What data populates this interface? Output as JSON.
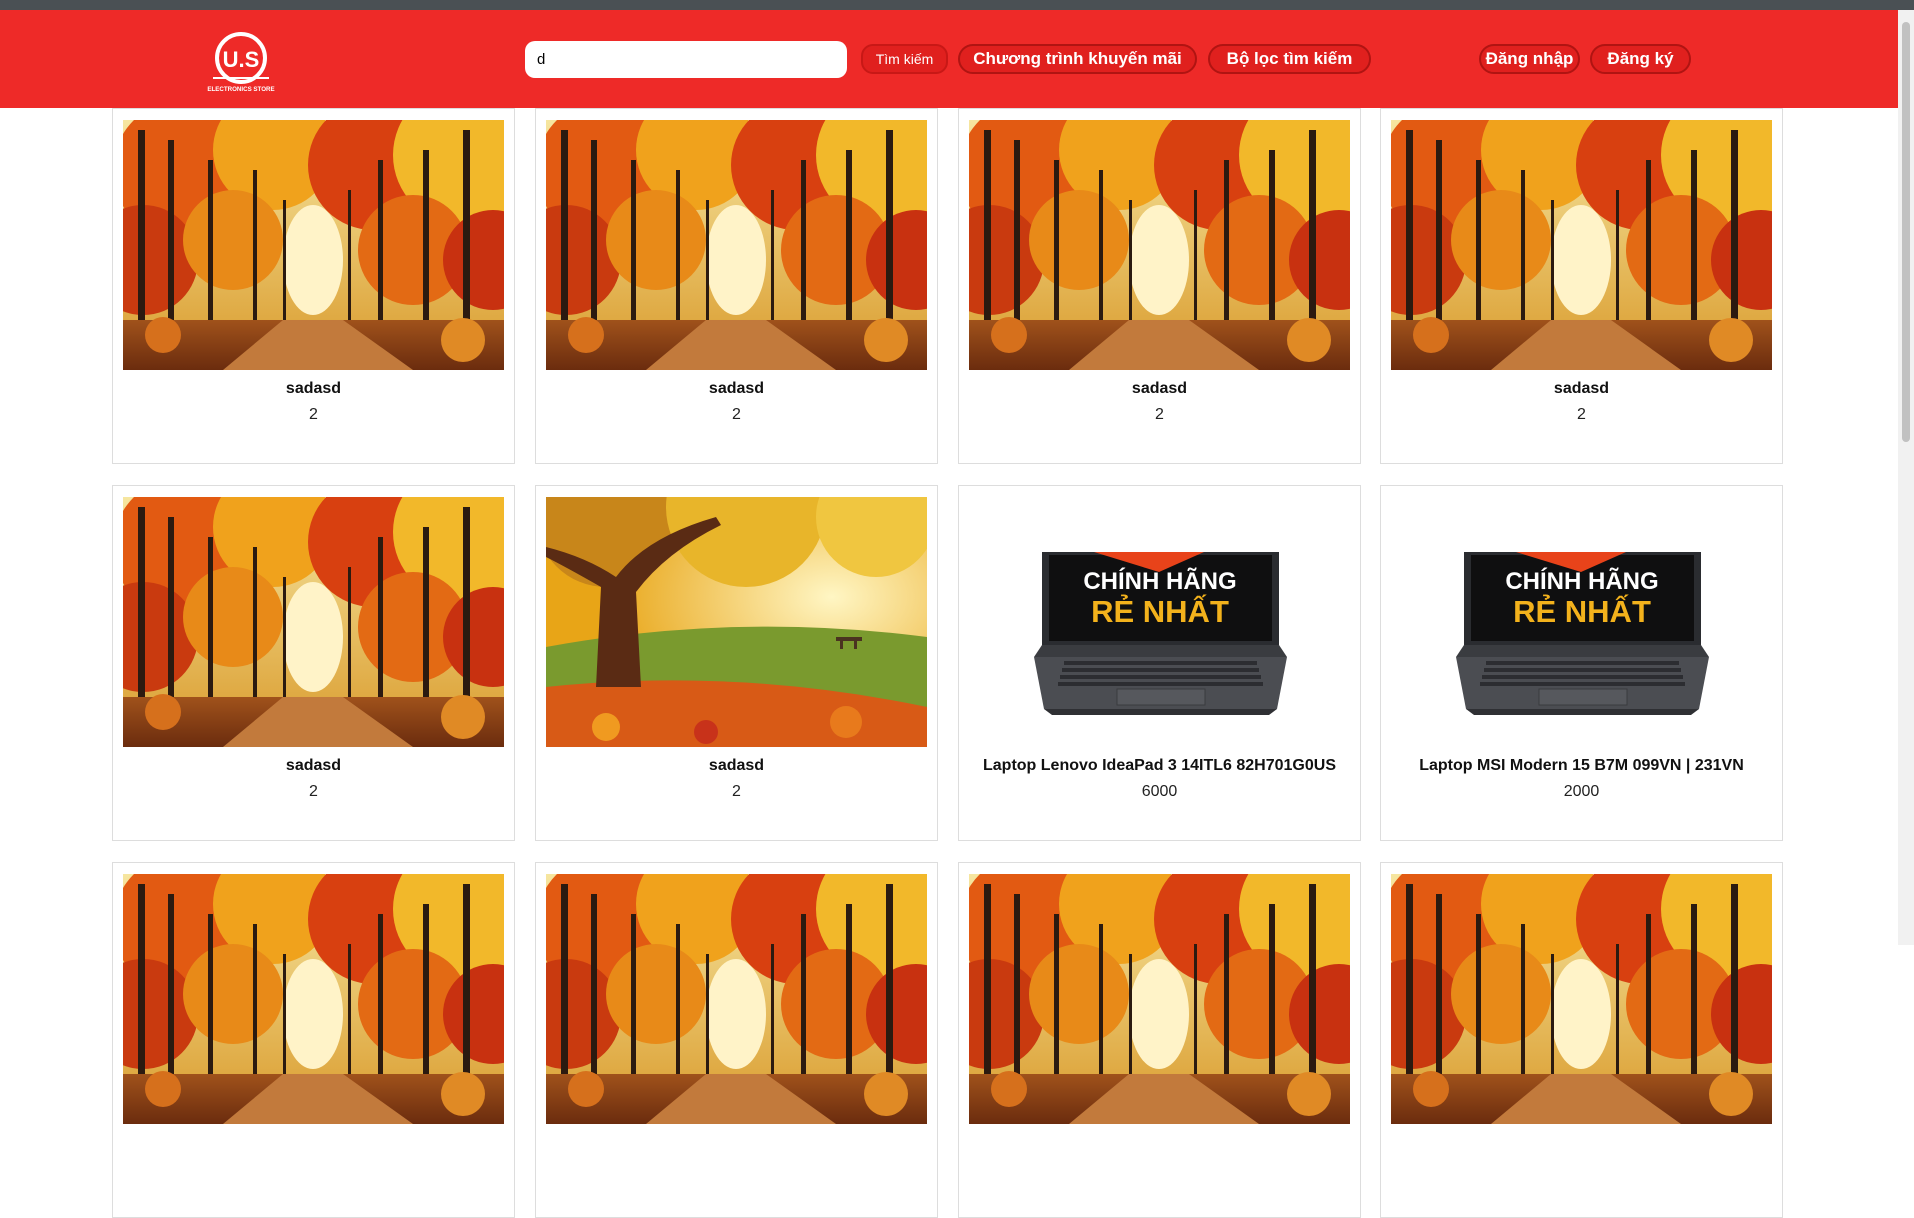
{
  "header": {
    "logo_text": "U.S",
    "logo_subtext": "ELECTRONICS STORE",
    "search_value": "d",
    "search_button": "Tìm kiếm",
    "promo_button": "Chương trình khuyến mãi",
    "filter_button": "Bộ lọc tìm kiếm",
    "login_button": "Đăng nhập",
    "register_button": "Đăng ký"
  },
  "colors": {
    "header_bg": "#ee2a28",
    "button_bg": "#e0201e",
    "button_border": "#b01412"
  },
  "products": [
    {
      "name": "sadasd",
      "price": "2",
      "image": "autumn-forest-path"
    },
    {
      "name": "sadasd",
      "price": "2",
      "image": "autumn-forest-path"
    },
    {
      "name": "sadasd",
      "price": "2",
      "image": "autumn-forest-path"
    },
    {
      "name": "sadasd",
      "price": "2",
      "image": "autumn-forest-path"
    },
    {
      "name": "sadasd",
      "price": "2",
      "image": "autumn-forest-path"
    },
    {
      "name": "sadasd",
      "price": "2",
      "image": "autumn-tree-meadow"
    },
    {
      "name": "Laptop Lenovo IdeaPad 3 14ITL6 82H701G0US",
      "price": "6000",
      "image": "laptop-promo",
      "promo_line1": "CHÍNH HÃNG",
      "promo_line2": "RẺ NHẤT"
    },
    {
      "name": "Laptop MSI Modern 15 B7M 099VN | 231VN",
      "price": "2000",
      "image": "laptop-promo",
      "promo_line1": "CHÍNH HÃNG",
      "promo_line2": "RẺ NHẤT"
    },
    {
      "name": "",
      "price": "",
      "image": "autumn-forest-path"
    },
    {
      "name": "",
      "price": "",
      "image": "autumn-forest-path"
    },
    {
      "name": "",
      "price": "",
      "image": "autumn-forest-path"
    },
    {
      "name": "",
      "price": "",
      "image": "autumn-forest-path"
    }
  ]
}
